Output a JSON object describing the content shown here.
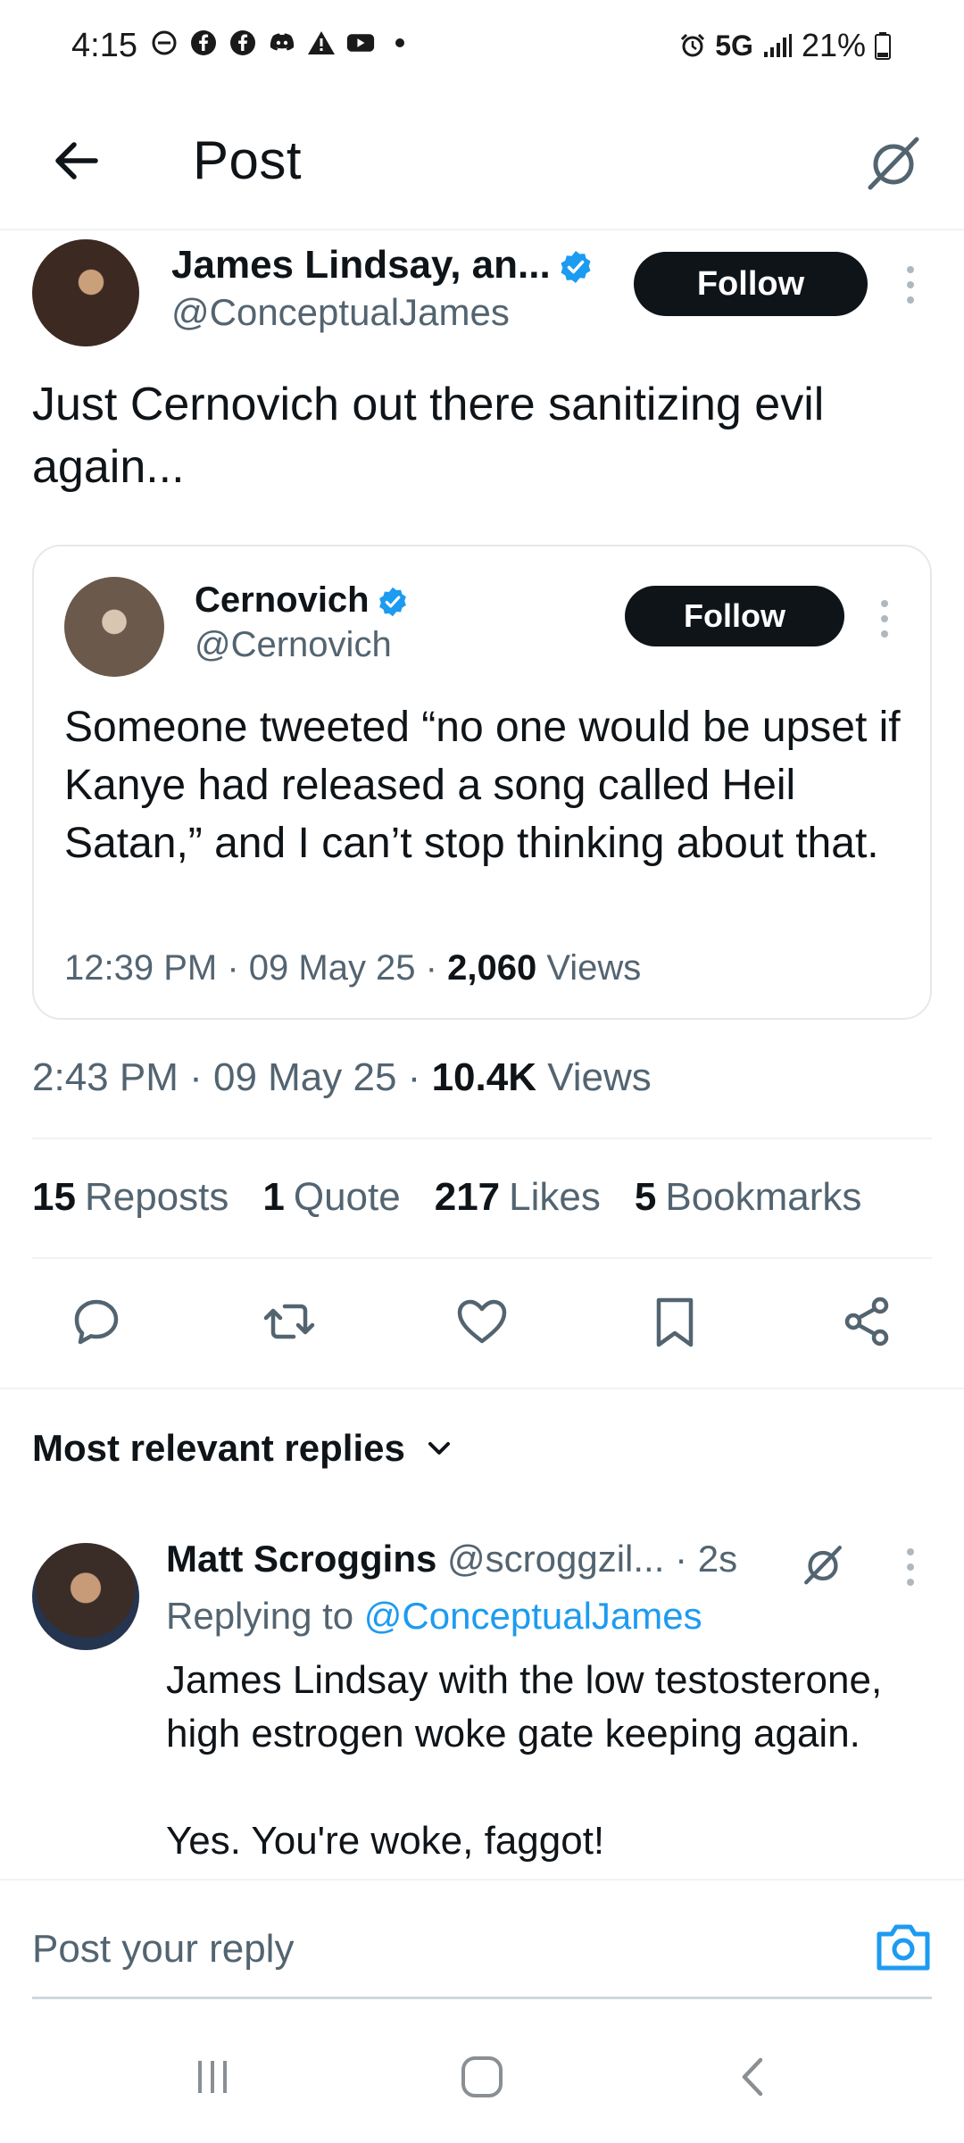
{
  "status_bar": {
    "time": "4:15",
    "network": "5G",
    "battery": "21%"
  },
  "header": {
    "title": "Post"
  },
  "post": {
    "author_name": "James Lindsay, an...",
    "author_handle": "@ConceptualJames",
    "follow_label": "Follow",
    "text": "Just Cernovich out there sanitizing evil again...",
    "time": "2:43 PM",
    "date": "09 May 25",
    "views_count": "10.4K",
    "views_label": "Views"
  },
  "quoted": {
    "author_name": "Cernovich",
    "author_handle": "@Cernovich",
    "follow_label": "Follow",
    "text": "Someone tweeted “no one would be upset if Kanye had released a song called Heil Satan,” and I can’t stop thinking about that.",
    "time": "12:39 PM",
    "date": "09 May 25",
    "views_count": "2,060",
    "views_label": "Views"
  },
  "stats": [
    {
      "count": "15",
      "label": "Reposts"
    },
    {
      "count": "1",
      "label": "Quote"
    },
    {
      "count": "217",
      "label": "Likes"
    },
    {
      "count": "5",
      "label": "Bookmarks"
    }
  ],
  "replies": {
    "sort_label": "Most relevant replies",
    "items": [
      {
        "name": "Matt Scroggins",
        "handle": "@scroggzil...",
        "age": "· 2s",
        "replying_prefix": "Replying to",
        "replying_to": "@ConceptualJames",
        "line1": "James Lindsay with the low testosterone, high estrogen woke gate keeping again.",
        "line2": "Yes. You're woke, faggot!"
      }
    ]
  },
  "composer": {
    "placeholder": "Post your reply"
  },
  "colors": {
    "link": "#1d9bf0",
    "verified": "#1d9bf0",
    "text_primary": "#0f1419",
    "text_secondary": "#536471"
  },
  "icons": {
    "back": "arrow-left-icon",
    "grok": "grok-icon",
    "verified": "verified-badge-icon",
    "reply": "reply-icon",
    "repost": "repost-icon",
    "like": "heart-icon",
    "bookmark": "bookmark-icon",
    "share": "share-icon",
    "camera": "camera-icon"
  }
}
